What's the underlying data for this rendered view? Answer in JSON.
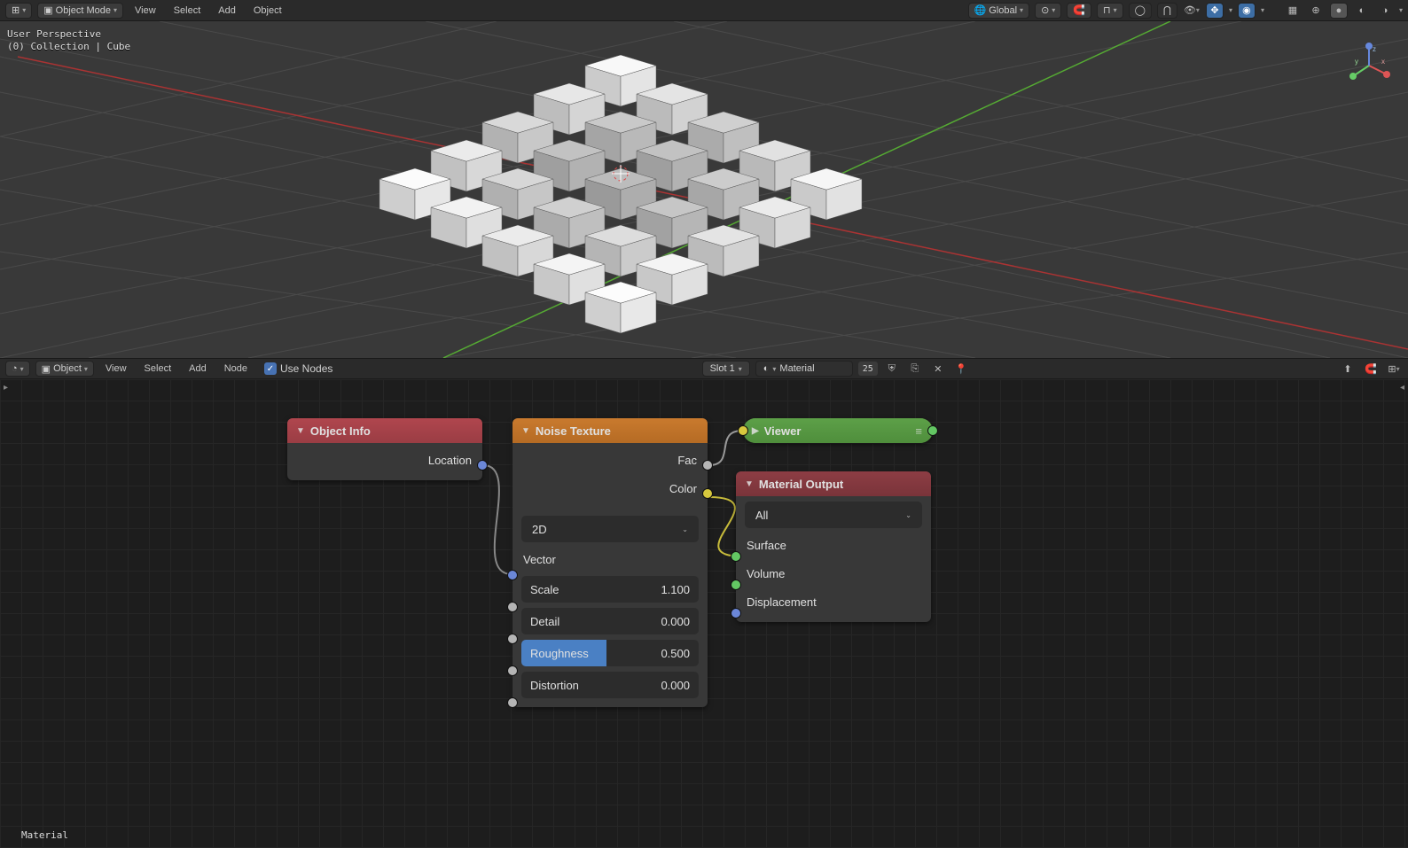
{
  "viewport_header": {
    "editor_type": "3D Viewport",
    "mode": "Object Mode",
    "menus": [
      "View",
      "Select",
      "Add",
      "Object"
    ],
    "orientation": "Global"
  },
  "viewport_overlay": {
    "line1": "User Perspective",
    "line2": "(0) Collection | Cube"
  },
  "node_header": {
    "editor_type": "Shader Editor",
    "mode": "Object",
    "menus": [
      "View",
      "Select",
      "Add",
      "Node"
    ],
    "use_nodes_label": "Use Nodes",
    "use_nodes": true,
    "slot": "Slot 1",
    "material_name": "Material",
    "users": "25"
  },
  "nodes": {
    "object_info": {
      "title": "Object Info",
      "outputs": [
        {
          "label": "Location",
          "type": "vec"
        }
      ]
    },
    "noise": {
      "title": "Noise Texture",
      "outputs": [
        {
          "label": "Fac",
          "type": "fac"
        },
        {
          "label": "Color",
          "type": "col"
        }
      ],
      "dimensions": "2D",
      "inputs": [
        {
          "label": "Vector",
          "type": "vec"
        }
      ],
      "params": [
        {
          "label": "Scale",
          "value": "1.100"
        },
        {
          "label": "Detail",
          "value": "0.000"
        },
        {
          "label": "Roughness",
          "value": "0.500",
          "highlight": true
        },
        {
          "label": "Distortion",
          "value": "0.000"
        }
      ]
    },
    "viewer": {
      "title": "Viewer"
    },
    "material_output": {
      "title": "Material Output",
      "target": "All",
      "inputs": [
        {
          "label": "Surface",
          "type": "shd"
        },
        {
          "label": "Volume",
          "type": "shd"
        },
        {
          "label": "Displacement",
          "type": "vec"
        }
      ]
    }
  },
  "bottom_material_label": "Material"
}
